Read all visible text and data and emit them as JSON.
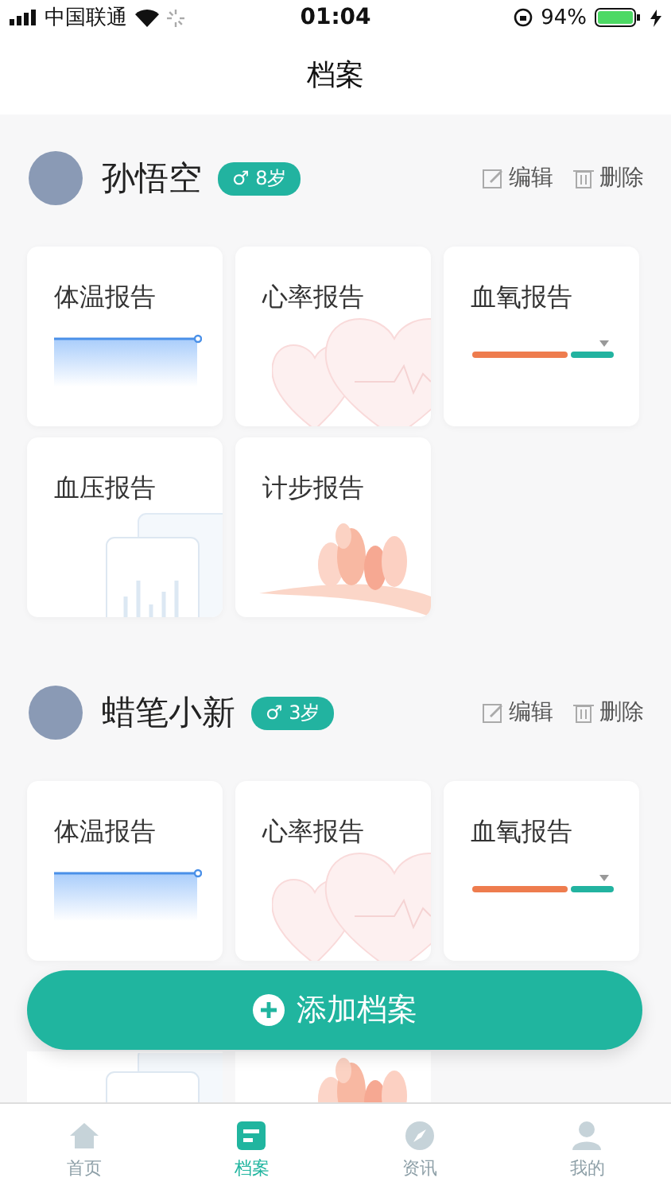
{
  "status_bar": {
    "carrier": "中国联通",
    "time": "01:04",
    "battery": "94%"
  },
  "nav": {
    "title": "档案"
  },
  "profiles": [
    {
      "name": "孙悟空",
      "gender": "♂",
      "age": "8岁",
      "edit": "编辑",
      "delete": "删除",
      "reports": [
        {
          "kind": "temperature",
          "label": "体温报告"
        },
        {
          "kind": "heart-rate",
          "label": "心率报告"
        },
        {
          "kind": "blood-oxygen",
          "label": "血氧报告"
        },
        {
          "kind": "blood-pressure",
          "label": "血压报告"
        },
        {
          "kind": "steps",
          "label": "计步报告"
        }
      ]
    },
    {
      "name": "蜡笔小新",
      "gender": "♂",
      "age": "3岁",
      "edit": "编辑",
      "delete": "删除",
      "reports": [
        {
          "kind": "temperature",
          "label": "体温报告"
        },
        {
          "kind": "heart-rate",
          "label": "心率报告"
        },
        {
          "kind": "blood-oxygen",
          "label": "血氧报告"
        },
        {
          "kind": "blood-pressure"
        },
        {
          "kind": "steps"
        }
      ]
    }
  ],
  "add_button": {
    "label": "添加档案"
  },
  "tabs": [
    {
      "label": "首页",
      "selected": false
    },
    {
      "label": "档案",
      "selected": true
    },
    {
      "label": "资讯",
      "selected": false
    },
    {
      "label": "我的",
      "selected": false
    }
  ]
}
